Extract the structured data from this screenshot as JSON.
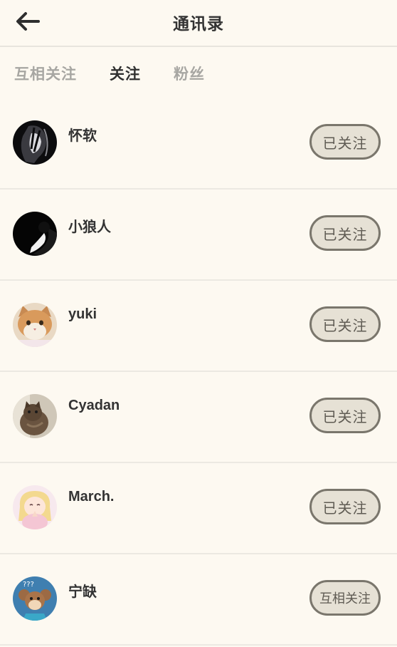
{
  "header": {
    "title": "通讯录"
  },
  "tabs": [
    {
      "label": "互相关注"
    },
    {
      "label": "关注"
    },
    {
      "label": "粉丝"
    }
  ],
  "contacts": [
    {
      "name": "怀软",
      "button": "已关注",
      "avatar": "dark-portrait"
    },
    {
      "name": "小狼人",
      "button": "已关注",
      "avatar": "black-silhouette"
    },
    {
      "name": "yuki",
      "button": "已关注",
      "avatar": "orange-cat"
    },
    {
      "name": "Cyadan",
      "button": "已关注",
      "avatar": "tabby-cat"
    },
    {
      "name": "March.",
      "button": "已关注",
      "avatar": "pink-anime"
    },
    {
      "name": "宁缺",
      "button": "互相关注",
      "avatar": "cartoon-mouse"
    }
  ],
  "colors": {
    "background": "#fdf9f1",
    "button_fill": "#e6e1d5",
    "button_border": "#7a766c",
    "active_tab": "#303030",
    "inactive_tab": "#a7a6a2"
  }
}
